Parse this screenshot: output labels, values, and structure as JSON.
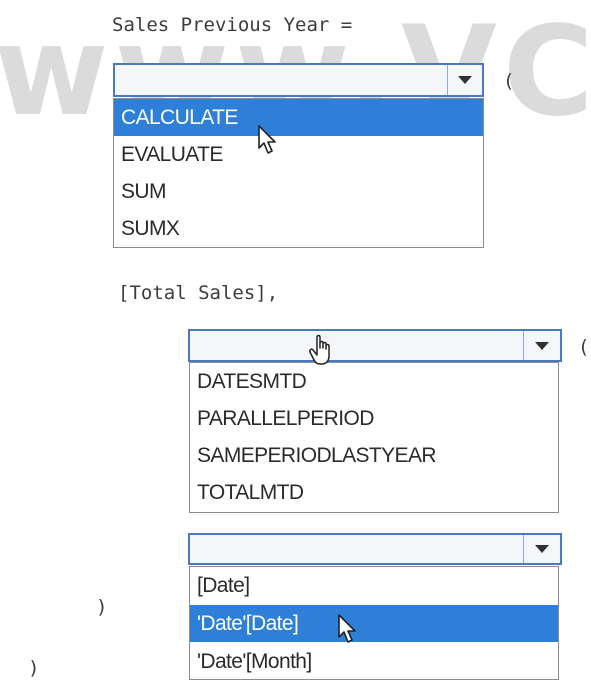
{
  "code": {
    "line1": "Sales Previous Year =",
    "paren_open_1": "(",
    "line_total_sales": "[Total Sales],",
    "paren_open_2": "(",
    "close_inner": ")",
    "close_outer": ")"
  },
  "dropdown1": {
    "value": "",
    "options": [
      "CALCULATE",
      "EVALUATE",
      "SUM",
      "SUMX"
    ],
    "selected": "CALCULATE"
  },
  "dropdown2": {
    "value": "",
    "options": [
      "DATESMTD",
      "PARALLELPERIOD",
      "SAMEPERIODLASTYEAR",
      "TOTALMTD"
    ]
  },
  "dropdown3": {
    "value": "",
    "options": [
      "[Date]",
      "'Date'[Date]",
      "'Date'[Month]"
    ],
    "selected": "'Date'[Date]"
  },
  "watermark": "www.VCEp",
  "colors": {
    "selection": "#2d7fd8",
    "dropdown_border": "#4a79c4",
    "dropdown_bg": "#f4f6fa"
  },
  "icons": [
    "chevron-down-icon",
    "arrow-cursor-icon",
    "hand-cursor-icon"
  ]
}
